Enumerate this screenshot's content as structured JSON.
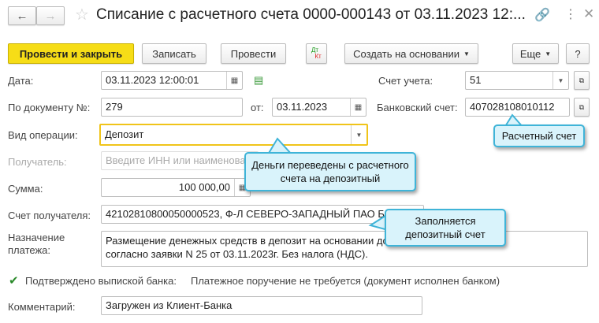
{
  "window": {
    "title": "Списание с расчетного счета 0000-000143 от 03.11.2023 12:..."
  },
  "toolbar": {
    "post_close": "Провести и закрыть",
    "save": "Записать",
    "post": "Провести",
    "dt": "Дт",
    "kt": "Кт",
    "create_based": "Создать на основании",
    "more": "Еще",
    "help": "?"
  },
  "form": {
    "date_label": "Дата:",
    "date": "03.11.2023 12:00:01",
    "account_label": "Счет учета:",
    "account": "51",
    "doc_label": "По документу №:",
    "doc_no": "279",
    "from_label": "от:",
    "doc_date": "03.11.2023",
    "bank_label": "Банковский счет:",
    "bank_account": "407028108010112",
    "op_label": "Вид операции:",
    "op": "Депозит",
    "recipient_label": "Получатель:",
    "recipient_placeholder": "Введите ИНН или наименование",
    "sum_label": "Сумма:",
    "sum": "100 000,00",
    "recipient_acc_label": "Счет получателя:",
    "recipient_acc": "42102810800050000523, Ф-Л СЕВЕРО-ЗАПАДНЫЙ ПАО БАНК",
    "purpose_label_1": "Назначение",
    "purpose_label_2": "платежа:",
    "purpose_1": "Размещение денежных средств в депозит на основании договора от 01.06.2023г.,",
    "purpose_2": "согласно заявки N 25 от 03.11.2023г. Без налога (НДС).",
    "confirmed": "Подтверждено выпиской банка:",
    "confirmed_checked": true,
    "payment_note": "Платежное поручение не требуется (документ исполнен банком)",
    "comment_label": "Комментарий:",
    "comment": "Загружен из Клиент-Банка"
  },
  "callouts": {
    "c1": "Расчетный счет",
    "c2_1": "Деньги переведены с расчетного",
    "c2_2": "счета на депозитный",
    "c3_1": "Заполняется",
    "c3_2": "депозитный счет"
  }
}
